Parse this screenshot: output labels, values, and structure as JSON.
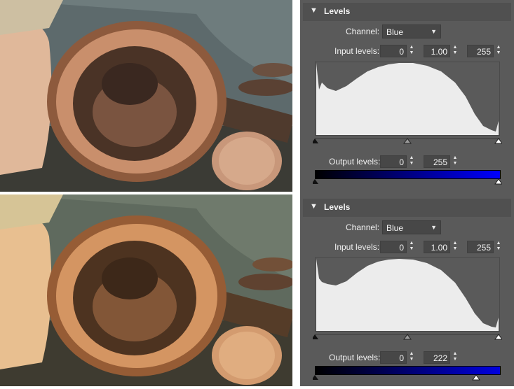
{
  "panels": [
    {
      "title": "Levels",
      "channel_label": "Channel:",
      "channel_value": "Blue",
      "input_label": "Input levels:",
      "input_black": "0",
      "input_gamma": "1.00",
      "input_white": "255",
      "output_label": "Output levels:",
      "output_black": "0",
      "output_white": "255"
    },
    {
      "title": "Levels",
      "channel_label": "Channel:",
      "channel_value": "Blue",
      "input_label": "Input levels:",
      "input_black": "0",
      "input_gamma": "1.00",
      "input_white": "255",
      "output_label": "Output levels:",
      "output_black": "0",
      "output_white": "222"
    }
  ],
  "colors": {
    "panel_bg": "#5a5a5a",
    "histogram_fill": "#ececec",
    "gradient_end_top": "#0000ff",
    "gradient_end_bottom": "#0000e0"
  },
  "icons": [
    "chevron-down-icon",
    "spin-up-down-icon",
    "black-point-triangle",
    "gamma-triangle",
    "white-point-triangle"
  ]
}
